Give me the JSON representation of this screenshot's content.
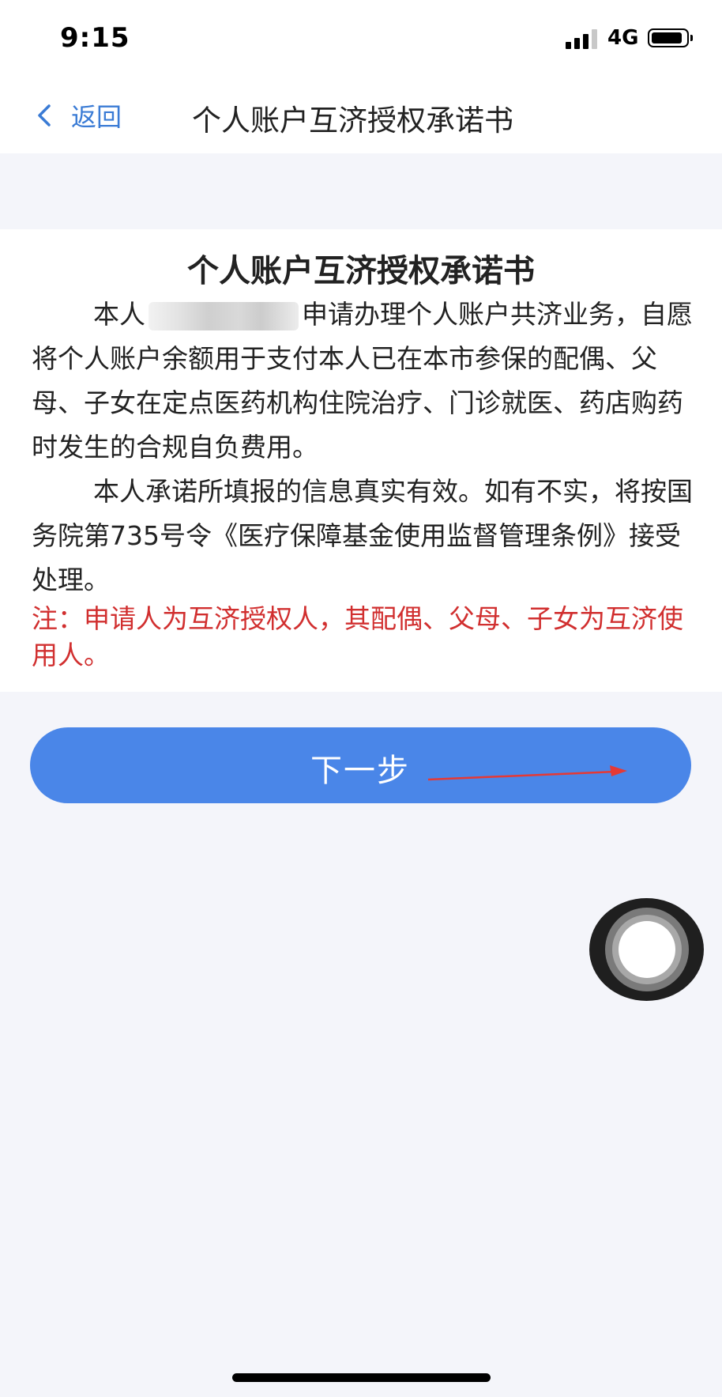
{
  "status_bar": {
    "time": "9:15",
    "network": "4G",
    "signal_bars_active": 3,
    "battery_level": 0.8
  },
  "nav": {
    "back_label": "返回",
    "title": "个人账户互济授权承诺书",
    "back_icon": "chevron-left-icon"
  },
  "document": {
    "title": "个人账户互济授权承诺书",
    "para1_prefix": "本人",
    "para1_rest": "申请办理个人账户共济业务，自愿将个人账户余额用于支付本人已在本市参保的配偶、父母、子女在定点医药机构住院治疗、门诊就医、药店购药时发生的合规自负费用。",
    "para2": "本人承诺所填报的信息真实有效。如有不实，将按国务院第735号令《医疗保障基金使用监督管理条例》接受处理。",
    "note": "注：申请人为互济授权人，其配偶、父母、子女为互济使用人。"
  },
  "actions": {
    "next_label": "下一步"
  },
  "colors": {
    "accent": "#4a86e8",
    "link": "#3a7bd5",
    "note": "#d12f2f",
    "background": "#f4f5fa"
  }
}
